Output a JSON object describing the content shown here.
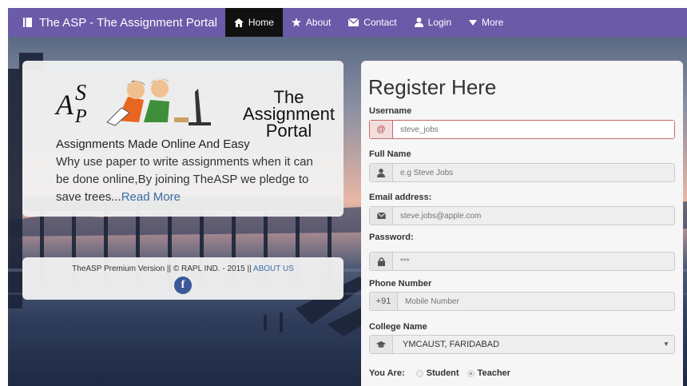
{
  "navbar": {
    "brand": "The ASP - The Assignment Portal",
    "items": [
      {
        "label": "Home",
        "icon": "home-icon",
        "active": true
      },
      {
        "label": "About",
        "icon": "star-icon",
        "active": false
      },
      {
        "label": "Contact",
        "icon": "envelope-icon",
        "active": false
      },
      {
        "label": "Login",
        "icon": "user-icon",
        "active": false
      },
      {
        "label": "More",
        "icon": "triangle-down-icon",
        "active": false
      }
    ]
  },
  "hero": {
    "logo_title_line1": "The",
    "logo_title_line2": "Assignment",
    "logo_title_line3": "Portal",
    "tagline": "Assignments Made Online And Easy",
    "description": "Why use paper to write assignments when it can be done online,By joining TheASP we pledge to save trees...",
    "read_more": "Read More"
  },
  "footer": {
    "text": "TheASP Premium Version || © RAPL IND. - 2015 || ",
    "link": "ABOUT US",
    "social_icon": "facebook-icon"
  },
  "register": {
    "title": "Register Here",
    "username": {
      "label": "Username",
      "addon": "@",
      "placeholder": "steve_jobs",
      "value": ""
    },
    "fullname": {
      "label": "Full Name",
      "placeholder": "e.g Steve Jobs",
      "value": ""
    },
    "email": {
      "label": "Email address:",
      "placeholder": "steve.jobs@apple.com",
      "value": ""
    },
    "password": {
      "label": "Password:",
      "placeholder": "***",
      "value": ""
    },
    "phone": {
      "label": "Phone Number",
      "addon": "+91",
      "placeholder": "Mobile Number",
      "value": ""
    },
    "college": {
      "label": "College Name",
      "selected": "YMCAUST, FARIDABAD"
    },
    "you_are": {
      "label": "You Are:",
      "options": [
        "Student",
        "Teacher"
      ],
      "selected": "Teacher"
    }
  },
  "colors": {
    "navbar": "#6a5aa8",
    "active_nav": "#111111",
    "link": "#3a6ea5",
    "focus_border": "#c96a6a"
  }
}
